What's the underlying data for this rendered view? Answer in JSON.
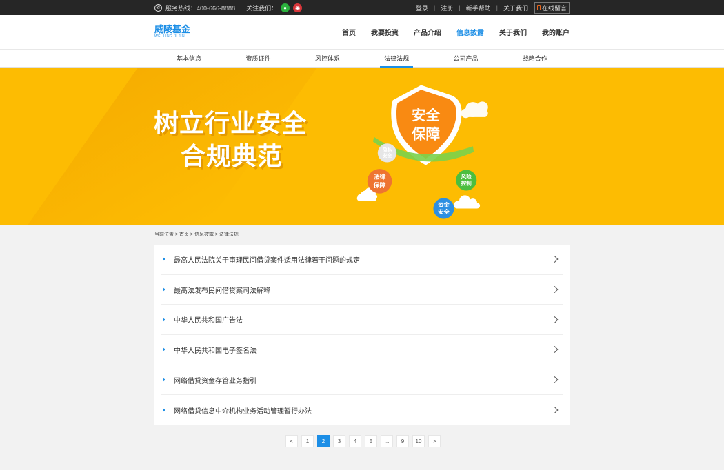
{
  "topbar": {
    "hotline": "服务热线：400-666-8888",
    "follow": "关注我们：",
    "links": [
      "登录",
      "注册",
      "新手帮助",
      "关于我们"
    ],
    "message": "在线留言"
  },
  "logo": {
    "cn": "威陵基金",
    "en": "WEI LING JI JIN"
  },
  "nav": {
    "items": [
      "首页",
      "我要投资",
      "产品介绍",
      "信息披露",
      "关于我们",
      "我的账户"
    ],
    "active_index": 3
  },
  "subnav": {
    "items": [
      "基本信息",
      "资质证件",
      "风控体系",
      "法律法规",
      "公司产品",
      "战略合作"
    ],
    "active_index": 3
  },
  "banner": {
    "line1": "树立行业安全",
    "line2": "合规典范",
    "shield_line1": "安全",
    "shield_line2": "保障",
    "bubbles": {
      "privacy": [
        "隐私",
        "安全"
      ],
      "legal": [
        "法律",
        "保障"
      ],
      "risk": [
        "风险",
        "控制"
      ],
      "funds": [
        "资金",
        "安全"
      ]
    }
  },
  "breadcrumb": "当前位置 > 首页 > 信息披露 > 法律法规",
  "articles": [
    "最高人民法院关于审理民间借贷案件适用法律若干问题的规定",
    "最高法发布民间借贷案司法解释",
    "中华人民共和国广告法",
    "中华人民共和国电子签名法",
    "网络借贷资金存管业务指引",
    "网络借贷信息中介机构业务活动管理暂行办法"
  ],
  "pagination": {
    "prev": "<",
    "next": ">",
    "pages": [
      "1",
      "2",
      "3",
      "4",
      "5",
      "...",
      "9",
      "10"
    ],
    "current": "2"
  },
  "colors": {
    "accent": "#1c8ee6",
    "banner": "#fdbc02",
    "topbar": "#262626"
  }
}
